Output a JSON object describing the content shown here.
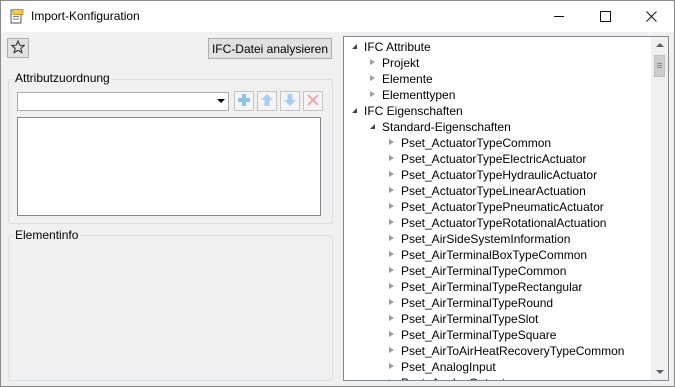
{
  "window": {
    "title": "Import-Konfiguration",
    "icon": "app-document-icon"
  },
  "toolbar": {
    "favorite_icon": "star-icon",
    "analyze_label": "IFC-Datei analysieren"
  },
  "attribute_mapping": {
    "label": "Attributzuordnung",
    "combo_value": "",
    "buttons": [
      "add-icon",
      "move-up-icon",
      "move-down-icon",
      "delete-icon"
    ]
  },
  "element_info": {
    "label": "Elementinfo"
  },
  "tree": {
    "items": [
      {
        "label": "IFC Attribute",
        "level": 0,
        "expanded": true
      },
      {
        "label": "Projekt",
        "level": 1,
        "expanded": false
      },
      {
        "label": "Elemente",
        "level": 1,
        "expanded": false
      },
      {
        "label": "Elementtypen",
        "level": 1,
        "expanded": false
      },
      {
        "label": "IFC Eigenschaften",
        "level": 0,
        "expanded": true
      },
      {
        "label": "Standard-Eigenschaften",
        "level": 1,
        "expanded": true
      },
      {
        "label": "Pset_ActuatorTypeCommon",
        "level": 2,
        "expanded": false
      },
      {
        "label": "Pset_ActuatorTypeElectricActuator",
        "level": 2,
        "expanded": false
      },
      {
        "label": "Pset_ActuatorTypeHydraulicActuator",
        "level": 2,
        "expanded": false
      },
      {
        "label": "Pset_ActuatorTypeLinearActuation",
        "level": 2,
        "expanded": false
      },
      {
        "label": "Pset_ActuatorTypePneumaticActuator",
        "level": 2,
        "expanded": false
      },
      {
        "label": "Pset_ActuatorTypeRotationalActuation",
        "level": 2,
        "expanded": false
      },
      {
        "label": "Pset_AirSideSystemInformation",
        "level": 2,
        "expanded": false
      },
      {
        "label": "Pset_AirTerminalBoxTypeCommon",
        "level": 2,
        "expanded": false
      },
      {
        "label": "Pset_AirTerminalTypeCommon",
        "level": 2,
        "expanded": false
      },
      {
        "label": "Pset_AirTerminalTypeRectangular",
        "level": 2,
        "expanded": false
      },
      {
        "label": "Pset_AirTerminalTypeRound",
        "level": 2,
        "expanded": false
      },
      {
        "label": "Pset_AirTerminalTypeSlot",
        "level": 2,
        "expanded": false
      },
      {
        "label": "Pset_AirTerminalTypeSquare",
        "level": 2,
        "expanded": false
      },
      {
        "label": "Pset_AirToAirHeatRecoveryTypeCommon",
        "level": 2,
        "expanded": false
      },
      {
        "label": "Pset_AnalogInput",
        "level": 2,
        "expanded": false
      },
      {
        "label": "Pset_AnalogOutput",
        "level": 2,
        "expanded": false
      }
    ]
  }
}
